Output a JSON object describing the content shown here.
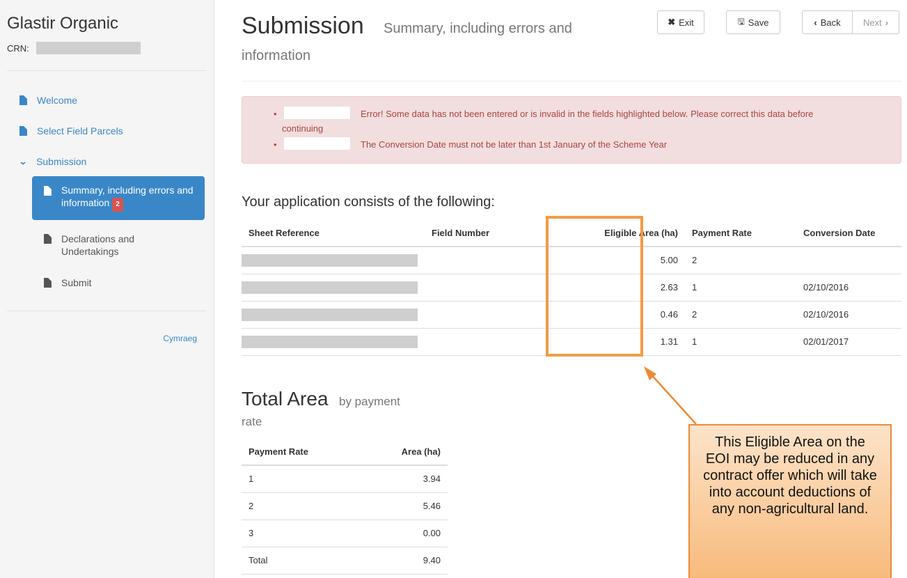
{
  "sidebar": {
    "app_title": "Glastir Organic",
    "crn_label": "CRN:",
    "items": [
      {
        "label": "Welcome"
      },
      {
        "label": "Select Field Parcels"
      },
      {
        "label": "Submission"
      }
    ],
    "sub_items": [
      {
        "label": "Summary, including errors and information",
        "badge": "2"
      },
      {
        "label_line1": "Declarations and",
        "label_line2": "Undertakings"
      },
      {
        "label": "Submit"
      }
    ],
    "language_link": "Cymraeg"
  },
  "header": {
    "title": "Submission",
    "subtitle": "Summary, including errors and",
    "subtitle2": "information"
  },
  "toolbar": {
    "exit_label": "Exit",
    "save_label": "Save",
    "back_label": "Back",
    "next_label": "Next"
  },
  "alerts": [
    {
      "text_line1": "Error! Some data has not been entered or is invalid in the fields highlighted below. Please correct this data before",
      "text_line2": "continuing"
    },
    {
      "text_line1": "The Conversion Date must not be later than 1st January of the Scheme Year"
    }
  ],
  "application": {
    "heading": "Your application consists of the following:",
    "columns": [
      "Sheet Reference",
      "Field Number",
      "Eligible Area (ha)",
      "Payment Rate",
      "Conversion Date"
    ],
    "rows": [
      {
        "area": "5.00",
        "rate": "2",
        "date": ""
      },
      {
        "area": "2.63",
        "rate": "1",
        "date": "02/10/2016"
      },
      {
        "area": "0.46",
        "rate": "2",
        "date": "02/10/2016"
      },
      {
        "area": "1.31",
        "rate": "1",
        "date": "02/01/2017"
      }
    ]
  },
  "totals": {
    "title": "Total Area",
    "subtitle": "by payment",
    "subtitle2": "rate",
    "columns": [
      "Payment Rate",
      "Area (ha)"
    ],
    "rows": [
      {
        "rate": "1",
        "area": "3.94"
      },
      {
        "rate": "2",
        "area": "5.46"
      },
      {
        "rate": "3",
        "area": "0.00"
      },
      {
        "rate": "Total",
        "area": "9.40"
      }
    ]
  },
  "callout": {
    "text": "This Eligible Area on the EOI may be reduced in any contract offer which will take into account deductions of any non-agricultural land."
  },
  "colors": {
    "accent": "#3a87c8",
    "alert_bg": "#f2dede",
    "alert_text": "#a94442",
    "highlight": "#f29b46",
    "badge": "#d9534f"
  },
  "icons": {
    "document": "document-icon",
    "chevron": "chevron-down-icon",
    "exit": "times-icon",
    "save": "floppy-disk-icon",
    "back": "chevron-left-icon",
    "next": "chevron-right-icon"
  }
}
